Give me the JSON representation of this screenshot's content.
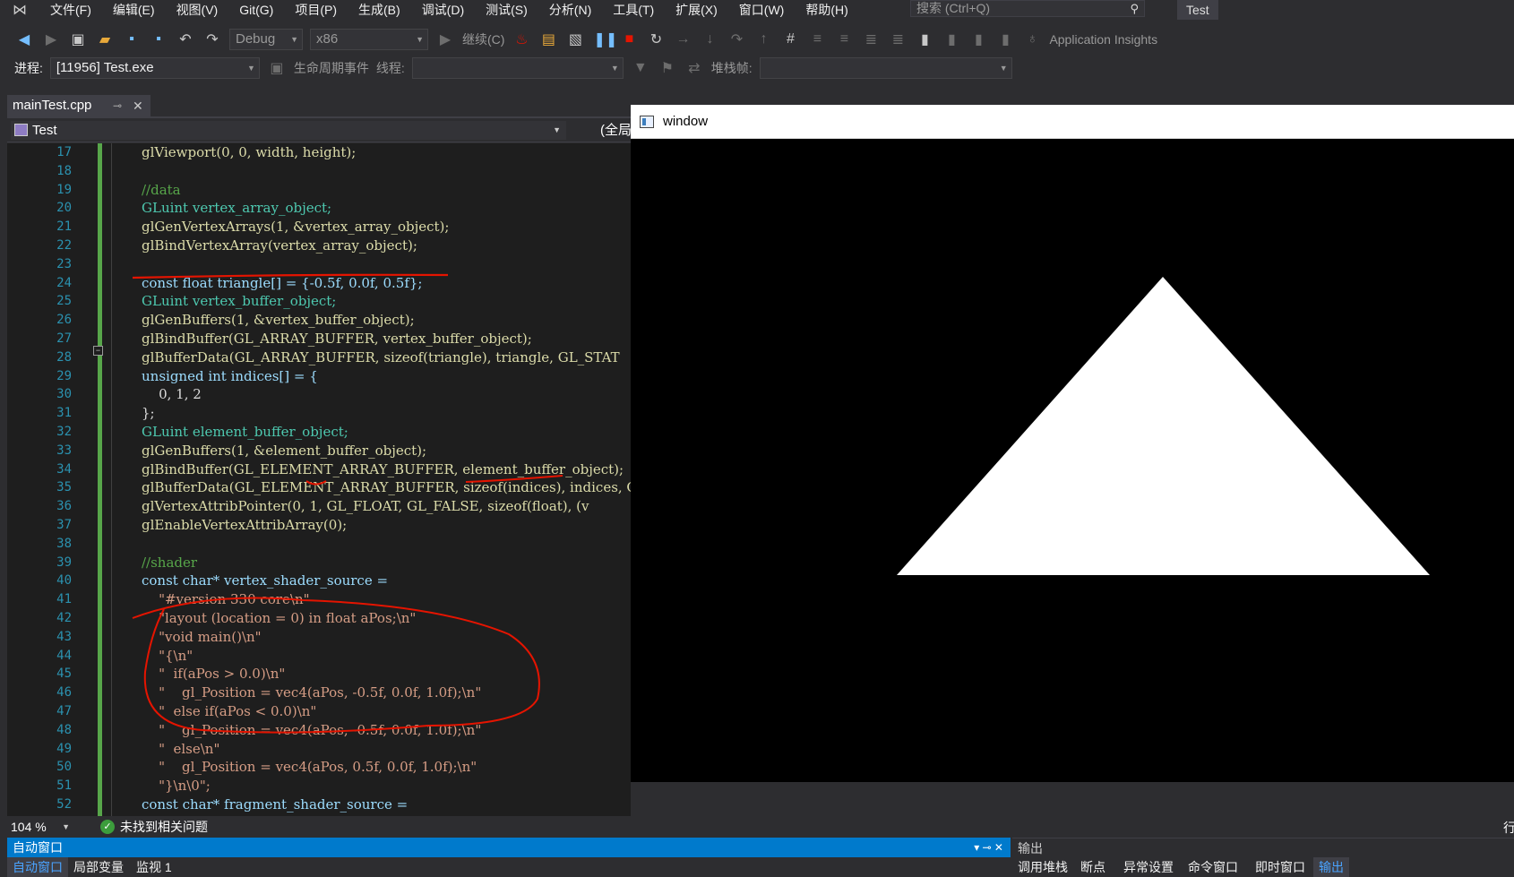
{
  "menubar": {
    "items": [
      "文件(F)",
      "编辑(E)",
      "视图(V)",
      "Git(G)",
      "项目(P)",
      "生成(B)",
      "调试(D)",
      "测试(S)",
      "分析(N)",
      "工具(T)",
      "扩展(X)",
      "窗口(W)",
      "帮助(H)"
    ],
    "search_placeholder": "搜索 (Ctrl+Q)",
    "solution_name": "Test"
  },
  "toolbar": {
    "config": "Debug",
    "platform": "x86",
    "continue_label": "继续(C)",
    "app_insights": "Application Insights",
    "process_label": "进程:",
    "process_value": "[11956] Test.exe",
    "lifecycle_label": "生命周期事件",
    "thread_label": "线程:",
    "stackframe_label": "堆栈帧:"
  },
  "editor": {
    "tab_name": "mainTest.cpp",
    "project": "Test",
    "scope": "(全局范围)",
    "lines": [
      {
        "n": "17",
        "t": "glViewport(0, 0, width, height);"
      },
      {
        "n": "18",
        "t": ""
      },
      {
        "n": "19",
        "t": "//data"
      },
      {
        "n": "20",
        "t": "GLuint vertex_array_object;"
      },
      {
        "n": "21",
        "t": "glGenVertexArrays(1, &vertex_array_object);"
      },
      {
        "n": "22",
        "t": "glBindVertexArray(vertex_array_object);"
      },
      {
        "n": "23",
        "t": ""
      },
      {
        "n": "24",
        "t": "const float triangle[] = {-0.5f, 0.0f, 0.5f};"
      },
      {
        "n": "25",
        "t": "GLuint vertex_buffer_object;"
      },
      {
        "n": "26",
        "t": "glGenBuffers(1, &vertex_buffer_object);"
      },
      {
        "n": "27",
        "t": "glBindBuffer(GL_ARRAY_BUFFER, vertex_buffer_object);"
      },
      {
        "n": "28",
        "t": "glBufferData(GL_ARRAY_BUFFER, sizeof(triangle), triangle, GL_STAT"
      },
      {
        "n": "29",
        "t": "unsigned int indices[] = {"
      },
      {
        "n": "30",
        "t": "    0, 1, 2"
      },
      {
        "n": "31",
        "t": "};"
      },
      {
        "n": "32",
        "t": "GLuint element_buffer_object;"
      },
      {
        "n": "33",
        "t": "glGenBuffers(1, &element_buffer_object);"
      },
      {
        "n": "34",
        "t": "glBindBuffer(GL_ELEMENT_ARRAY_BUFFER, element_buffer_object);"
      },
      {
        "n": "35",
        "t": "glBufferData(GL_ELEMENT_ARRAY_BUFFER, sizeof(indices), indices, G"
      },
      {
        "n": "36",
        "t": "glVertexAttribPointer(0, 1, GL_FLOAT, GL_FALSE, sizeof(float), (v"
      },
      {
        "n": "37",
        "t": "glEnableVertexAttribArray(0);"
      },
      {
        "n": "38",
        "t": ""
      },
      {
        "n": "39",
        "t": "//shader"
      },
      {
        "n": "40",
        "t": "const char* vertex_shader_source ="
      },
      {
        "n": "41",
        "t": "    \"#version 330 core\\n\""
      },
      {
        "n": "42",
        "t": "    \"layout (location = 0) in float aPos;\\n\""
      },
      {
        "n": "43",
        "t": "    \"void main()\\n\""
      },
      {
        "n": "44",
        "t": "    \"{\\n\""
      },
      {
        "n": "45",
        "t": "    \"  if(aPos > 0.0)\\n\""
      },
      {
        "n": "46",
        "t": "    \"    gl_Position = vec4(aPos, -0.5f, 0.0f, 1.0f);\\n\""
      },
      {
        "n": "47",
        "t": "    \"  else if(aPos < 0.0)\\n\""
      },
      {
        "n": "48",
        "t": "    \"    gl_Position = vec4(aPos, -0.5f, 0.0f, 1.0f);\\n\""
      },
      {
        "n": "49",
        "t": "    \"  else\\n\""
      },
      {
        "n": "50",
        "t": "    \"    gl_Position = vec4(aPos, 0.5f, 0.0f, 1.0f);\\n\""
      },
      {
        "n": "51",
        "t": "    \"}\\n\\0\";"
      },
      {
        "n": "52",
        "t": "const char* fragment_shader_source ="
      }
    ]
  },
  "window": {
    "title": "window"
  },
  "status": {
    "zoom": "104 %",
    "issues": "未找到相关问题",
    "row_label": "行"
  },
  "panels": {
    "left_title": "自动窗口",
    "right_title": "输出",
    "left_tabs": [
      "自动窗口",
      "局部变量",
      "监视 1"
    ],
    "right_tabs": [
      "调用堆栈",
      "断点",
      "异常设置",
      "命令窗口",
      "即时窗口",
      "输出"
    ]
  },
  "colors": {
    "accent": "#007acc",
    "editor_bg": "#1e1e1e",
    "annotation": "#e51400"
  }
}
